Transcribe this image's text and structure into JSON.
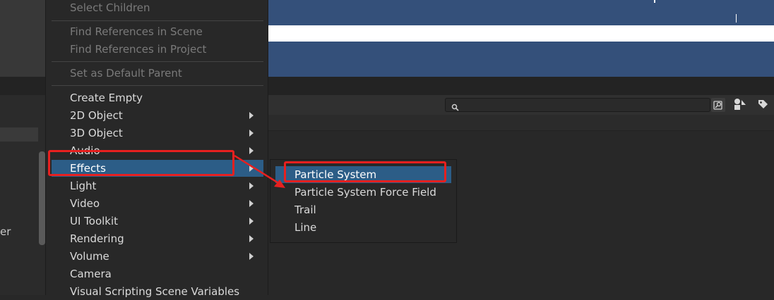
{
  "context_menu": {
    "items": [
      {
        "label": "Select Children",
        "disabled": true
      },
      {
        "label": "Find References in Scene",
        "disabled": true
      },
      {
        "label": "Find References in Project",
        "disabled": true
      },
      {
        "label": "Set as Default Parent",
        "disabled": true
      },
      {
        "label": "Create Empty"
      },
      {
        "label": "2D Object",
        "submenu": true
      },
      {
        "label": "3D Object",
        "submenu": true
      },
      {
        "label": "Audio",
        "submenu": true
      },
      {
        "label": "Effects",
        "submenu": true,
        "highlighted": true
      },
      {
        "label": "Light",
        "submenu": true
      },
      {
        "label": "Video",
        "submenu": true
      },
      {
        "label": "UI Toolkit",
        "submenu": true
      },
      {
        "label": "Rendering",
        "submenu": true
      },
      {
        "label": "Volume",
        "submenu": true
      },
      {
        "label": "Camera"
      },
      {
        "label": "Visual Scripting Scene Variables"
      }
    ]
  },
  "effects_submenu": {
    "items": [
      {
        "label": "Particle System",
        "highlighted": true
      },
      {
        "label": "Particle System Force Field"
      },
      {
        "label": "Trail"
      },
      {
        "label": "Line"
      }
    ]
  },
  "left_panel": {
    "partial_text": "er"
  },
  "project_toolbar": {
    "search": {
      "value": "",
      "placeholder": ""
    },
    "icons": {
      "search": "search-icon",
      "save_search": "save-search-icon",
      "filter_type": "shapes-icon",
      "filter_label": "tag-icon"
    }
  },
  "colors": {
    "menu_bg": "#282828",
    "highlight": "#2c5d87",
    "annotation": "#e8201f",
    "scene_blue": "#34507a"
  }
}
